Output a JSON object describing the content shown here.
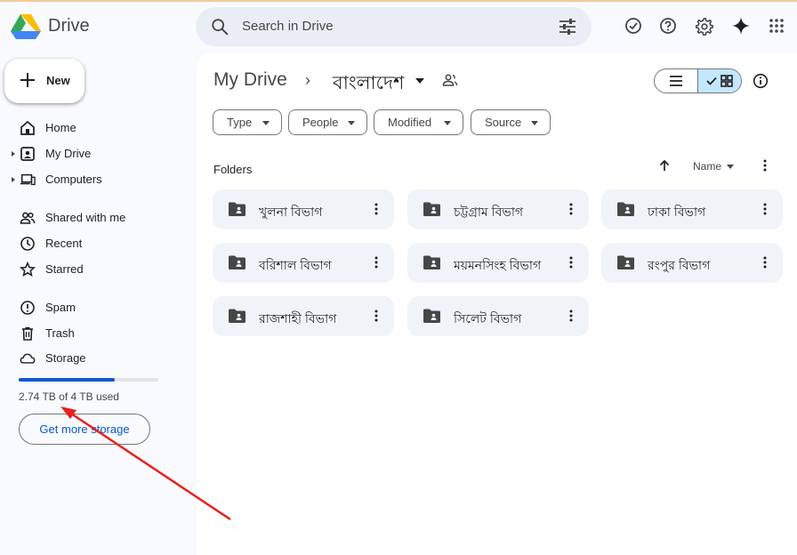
{
  "app": {
    "name": "Drive"
  },
  "search": {
    "placeholder": "Search in Drive"
  },
  "header_icons": [
    "ready-for-offline-icon",
    "help-icon",
    "settings-icon",
    "gemini-sparkle-icon",
    "apps-grid-icon"
  ],
  "sidebar": {
    "new_label": "New",
    "items": [
      {
        "label": "Home",
        "icon": "home-icon"
      },
      {
        "label": "My Drive",
        "icon": "my-drive-icon"
      },
      {
        "label": "Computers",
        "icon": "computers-icon"
      },
      {
        "label": "Shared with me",
        "icon": "shared-icon"
      },
      {
        "label": "Recent",
        "icon": "clock-icon"
      },
      {
        "label": "Starred",
        "icon": "star-icon"
      },
      {
        "label": "Spam",
        "icon": "spam-icon"
      },
      {
        "label": "Trash",
        "icon": "trash-icon"
      },
      {
        "label": "Storage",
        "icon": "cloud-icon"
      }
    ],
    "storage": {
      "used_text": "2.74 TB of 4 TB used",
      "used_fraction": 0.685,
      "button": "Get more storage"
    }
  },
  "breadcrumb": {
    "root": "My Drive",
    "separator": "›",
    "current": "বাংলাদেশ"
  },
  "filters": [
    "Type",
    "People",
    "Modified",
    "Source"
  ],
  "section": {
    "folders_label": "Folders",
    "sort_label": "Name"
  },
  "folders": [
    "খুলনা বিভাগ",
    "চট্টগ্রাম বিভাগ",
    "ঢাকা বিভাগ",
    "বরিশাল বিভাগ",
    "ময়মনসিংহ বিভাগ",
    "রংপুর বিভাগ",
    "রাজশাহী বিভাগ",
    "সিলেট বিভাগ"
  ],
  "colors": {
    "accent": "#0b57d0",
    "selected_view": "#c2e7ff",
    "annotation_arrow": "#e8211d"
  }
}
